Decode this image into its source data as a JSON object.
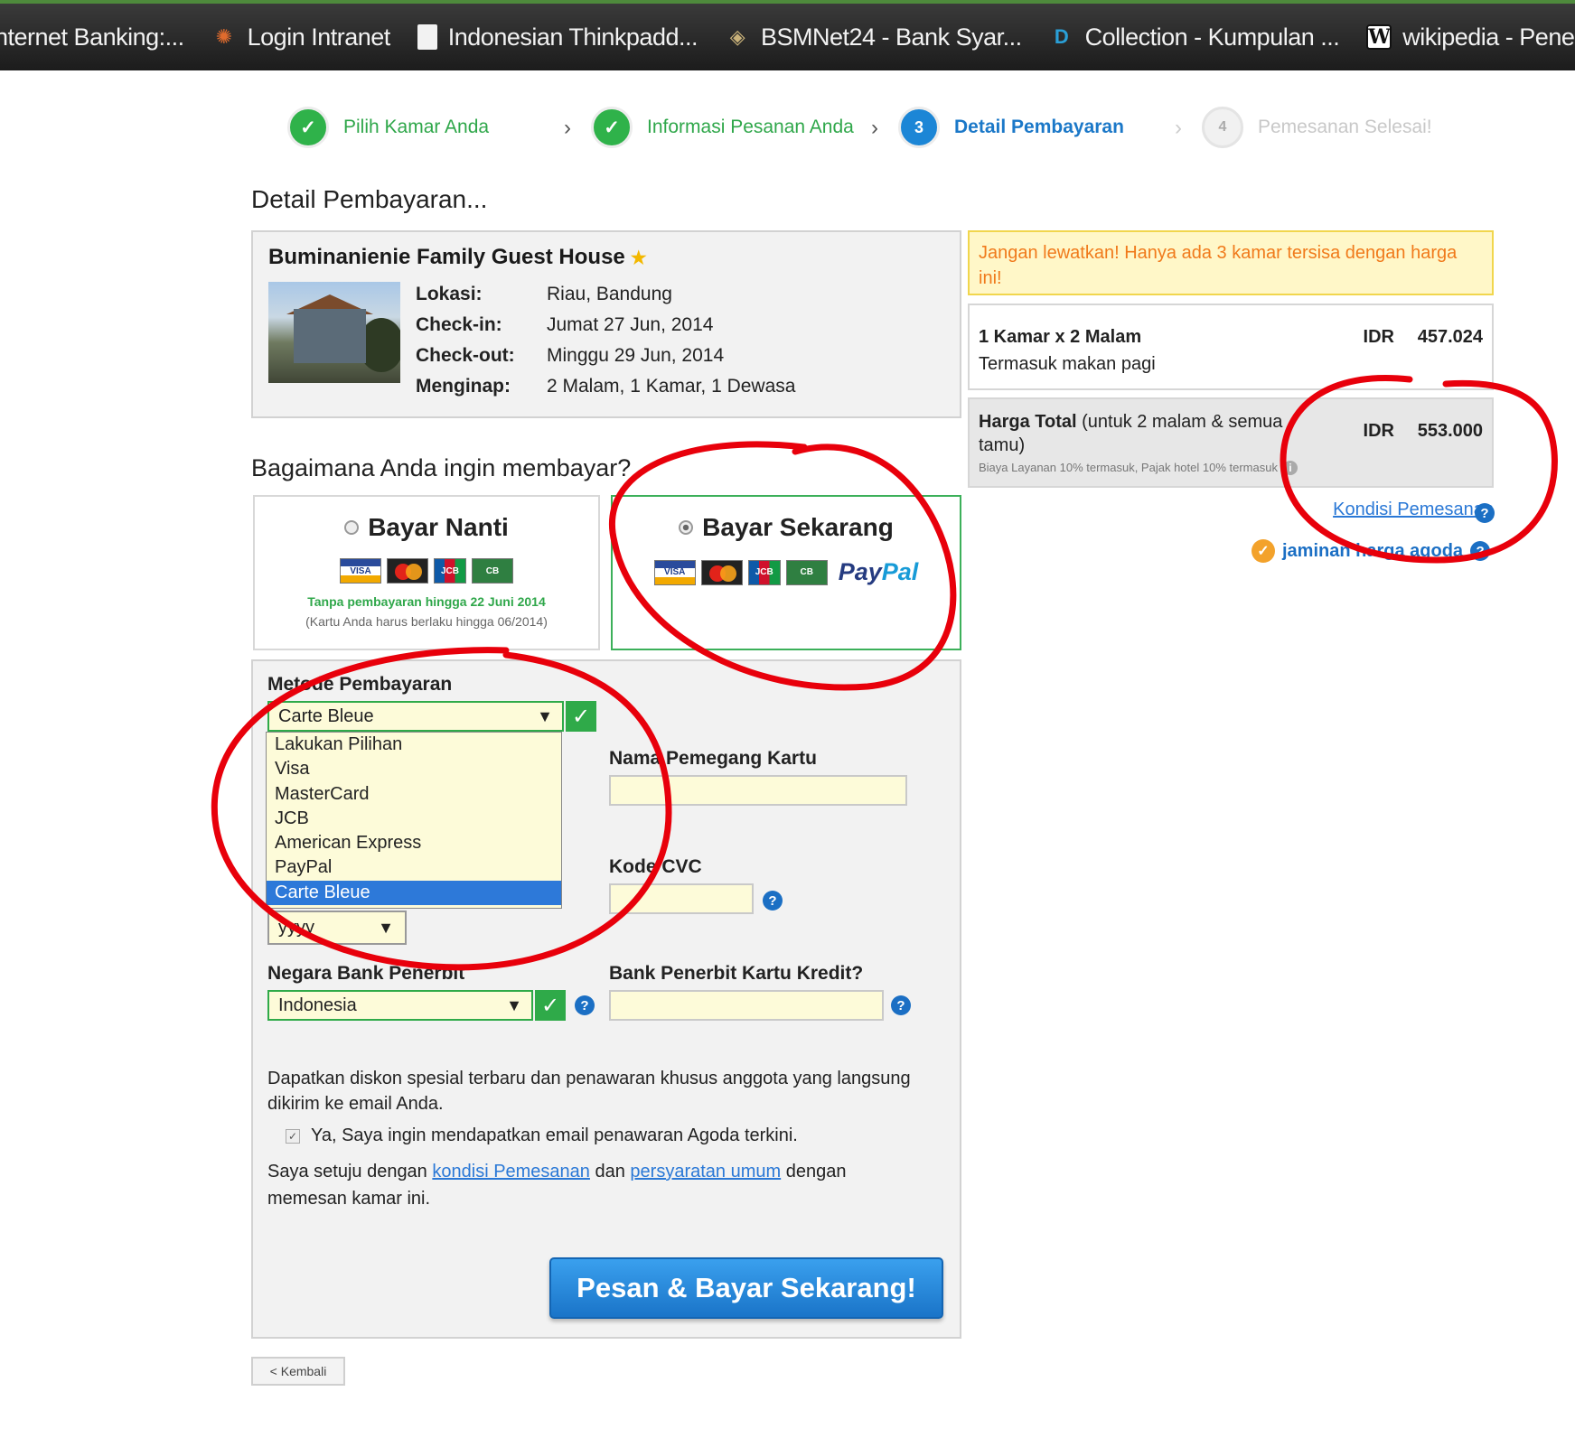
{
  "bookmarks": [
    {
      "label": "nternet Banking:...",
      "icon": "none"
    },
    {
      "label": "Login Intranet",
      "icon": "gear-icon"
    },
    {
      "label": "Indonesian Thinkpadd...",
      "icon": "document-icon"
    },
    {
      "label": "BSMNet24 - Bank Syar...",
      "icon": "diamond-icon"
    },
    {
      "label": "Collection - Kumpulan ...",
      "icon": "d-logo-icon"
    },
    {
      "label": "wikipedia - Penelusu",
      "icon": "wikipedia-icon"
    }
  ],
  "steps": [
    {
      "num": "✓",
      "label": "Pilih Kamar Anda",
      "state": "done"
    },
    {
      "num": "✓",
      "label": "Informasi Pesanan Anda",
      "state": "done"
    },
    {
      "num": "3",
      "label": "Detail Pembayaran",
      "state": "active"
    },
    {
      "num": "4",
      "label": "Pemesanan Selesai!",
      "state": "todo"
    }
  ],
  "page_title": "Detail Pembayaran...",
  "hotel": {
    "name": "Buminanienie Family Guest House",
    "star": "★",
    "rows": [
      {
        "key": "Lokasi:",
        "value": "Riau, Bandung"
      },
      {
        "key": "Check-in:",
        "value": "Jumat 27 Jun, 2014"
      },
      {
        "key": "Check-out:",
        "value": "Minggu 29 Jun, 2014"
      },
      {
        "key": "Menginap:",
        "value": "2 Malam, 1 Kamar, 1 Dewasa"
      }
    ]
  },
  "urgency": "Jangan lewatkan! Hanya ada 3 kamar tersisa dengan harga ini!",
  "price": {
    "room_line1": "1 Kamar x 2 Malam",
    "room_line2": "Termasuk makan pagi",
    "room_currency": "IDR",
    "room_value": "457.024",
    "total_bold": "Harga Total",
    "total_rest": " (untuk 2 malam & semua",
    "total_line2": "tamu)",
    "total_currency": "IDR",
    "total_value": "553.000",
    "fee_note": "Biaya Layanan 10% termasuk, Pajak hotel 10% termasuk",
    "info": "i"
  },
  "kondisi_link": "Kondisi Pemesanan",
  "jaminan": "jaminan harga agoda",
  "how_pay": "Bagaimana Anda ingin membayar?",
  "pay_later": {
    "title": "Bayar Nanti",
    "note_green": "Tanpa pembayaran hingga 22 Juni 2014",
    "note_grey": "(Kartu Anda harus berlaku hingga 06/2014)"
  },
  "pay_now": {
    "title": "Bayar Sekarang",
    "paypal1": "Pay",
    "paypal2": "Pal"
  },
  "card_labels": {
    "visa": "VISA",
    "jcb": "JCB",
    "cb": "CB"
  },
  "form": {
    "method_label": "Metode Pembayaran",
    "method_value": "Carte Bleue",
    "method_options": [
      "Lakukan Pilihan",
      "Visa",
      "MasterCard",
      "JCB",
      "American Express",
      "PayPal",
      "Carte Bleue"
    ],
    "holder_label": "Nama Pemegang Kartu",
    "cvc_label": "Kode CVC",
    "year_value": "yyyy",
    "country_label": "Negara Bank Penerbit",
    "country_value": "Indonesia",
    "bank_label": "Bank Penerbit Kartu Kredit?",
    "promo": "Dapatkan diskon spesial terbaru dan penawaran khusus anggota yang langsung dikirim ke email Anda.",
    "checkbox_label": "Ya, Saya ingin mendapatkan email penawaran Agoda terkini.",
    "agree_pre": "Saya setuju dengan ",
    "agree_link1": "kondisi Pemesanan",
    "agree_mid": " dan ",
    "agree_link2": "persyaratan umum",
    "agree_post": " dengan memesan kamar ini.",
    "submit": "Pesan & Bayar Sekarang!",
    "back": "< Kembali"
  },
  "symbols": {
    "check": "✓",
    "arrow": "▼",
    "help": "?",
    "chevron": "›"
  },
  "colors": {
    "accent_green": "#2fb24a",
    "accent_blue": "#1c86d6",
    "annotation_red": "#e8000b",
    "urgency": "#f07a1b"
  }
}
